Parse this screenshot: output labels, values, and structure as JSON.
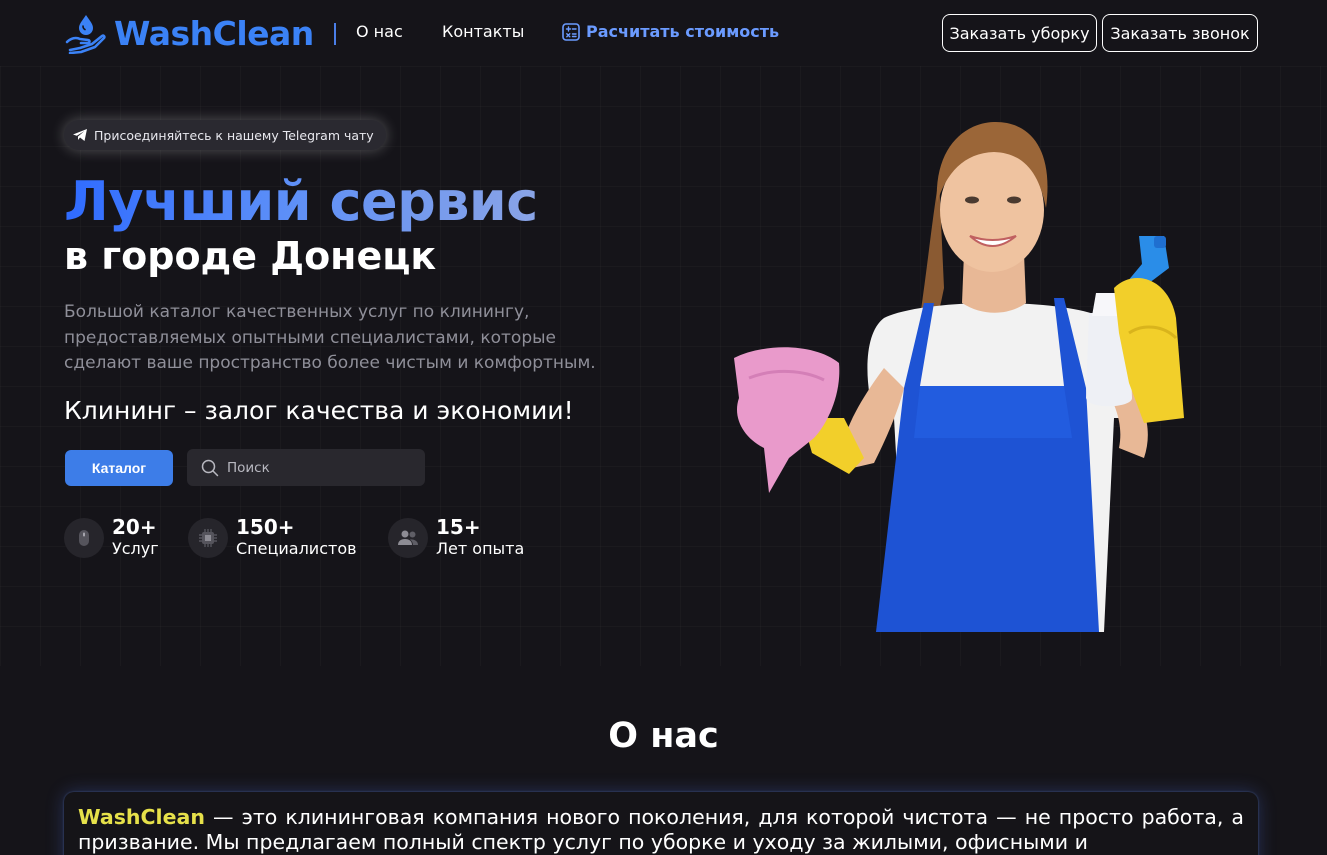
{
  "header": {
    "logo": "WashClean",
    "nav": {
      "about": "О нас",
      "contacts": "Контакты",
      "calc": "Расчитать стоимость"
    },
    "order_cleaning": "Заказать уборку",
    "order_call": "Заказать звонок"
  },
  "hero": {
    "telegram_badge": "Присоединяйтесь к нашему Telegram чату",
    "title_line1": "Лучший сервис",
    "title_line2": "в городе Донецк",
    "description": "Большой каталог качественных услуг по клинингу, предоставляемых опытными специалистами, которые сделают ваше пространство более чистым и комфортным.",
    "slogan": "Клининг – залог качества и экономии!",
    "catalog_button": "Каталог",
    "search_placeholder": "Поиск",
    "stats": [
      {
        "value": "20+",
        "label": "Услуг",
        "icon": "mouse-icon"
      },
      {
        "value": "150+",
        "label": "Специалистов",
        "icon": "chip-icon"
      },
      {
        "value": "15+",
        "label": "Лет опыта",
        "icon": "users-icon"
      }
    ]
  },
  "about": {
    "title": "О нас",
    "brand": "WashClean",
    "text": " — это клининговая компания нового поколения, для которой чистота — не просто работа, а призвание. Мы предлагаем полный спектр услуг по уборке и уходу за жилыми, офисными и"
  },
  "colors": {
    "background": "#151419",
    "accent": "#3d7de8",
    "brand_highlight": "#e6e14a"
  }
}
